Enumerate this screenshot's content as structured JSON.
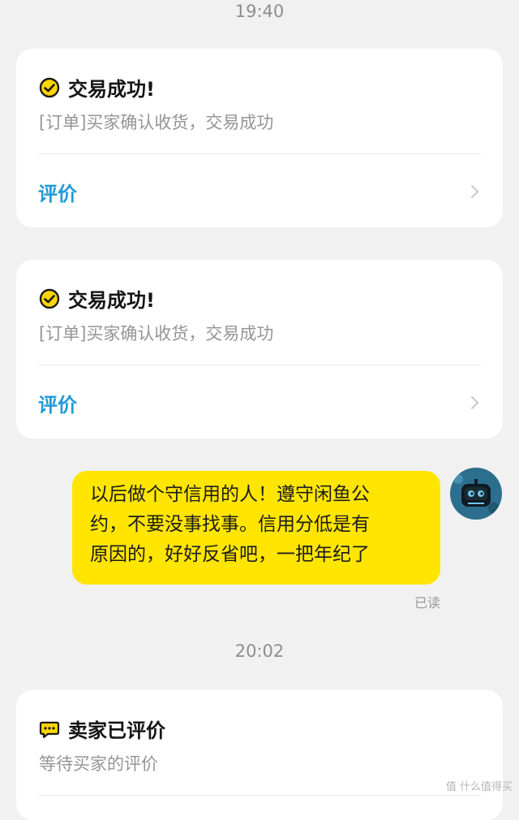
{
  "timestamps": [
    "19:40",
    "20:02"
  ],
  "cards": [
    {
      "title": "交易成功!",
      "subtitle": "[订单]买家确认收货，交易成功",
      "action": "评价"
    },
    {
      "title": "交易成功!",
      "subtitle": "[订单]买家确认收货，交易成功",
      "action": "评价"
    },
    {
      "title": "卖家已评价",
      "subtitle": "等待买家的评价"
    }
  ],
  "message": {
    "lines": [
      "以后做个守信用的人！遵守闲鱼公",
      "约，不要没事找事。信用分低是有",
      "原因的，好好反省吧，一把年纪了"
    ],
    "status": "已读"
  },
  "watermark": "值 什么值得买",
  "colors": {
    "bubble": "#ffe500",
    "accent_blue": "#1f9ad6",
    "check_yellow": "#ffd600"
  }
}
